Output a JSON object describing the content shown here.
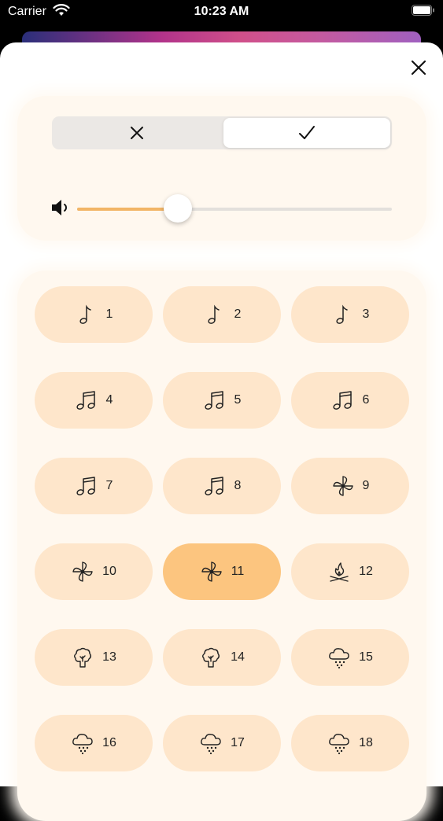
{
  "status_bar": {
    "carrier": "Carrier",
    "time": "10:23 AM"
  },
  "header": {
    "close_icon": "close-icon"
  },
  "mode_toggle": {
    "options": [
      {
        "icon": "x-icon",
        "selected": false
      },
      {
        "icon": "checkmark-icon",
        "selected": true
      }
    ]
  },
  "volume": {
    "icon": "speaker-icon",
    "level": 0.32,
    "fill_color": "#f2b566"
  },
  "sounds": {
    "selected_index": 10,
    "button_color": "#fee6cb",
    "selected_color": "#fcc57f",
    "items": [
      {
        "label": "1",
        "icon": "music-note-icon"
      },
      {
        "label": "2",
        "icon": "music-note-icon"
      },
      {
        "label": "3",
        "icon": "music-note-icon"
      },
      {
        "label": "4",
        "icon": "double-music-note-icon"
      },
      {
        "label": "5",
        "icon": "double-music-note-icon"
      },
      {
        "label": "6",
        "icon": "double-music-note-icon"
      },
      {
        "label": "7",
        "icon": "double-music-note-icon"
      },
      {
        "label": "8",
        "icon": "double-music-note-icon"
      },
      {
        "label": "9",
        "icon": "fan-icon"
      },
      {
        "label": "10",
        "icon": "fan-icon"
      },
      {
        "label": "11",
        "icon": "fan-icon"
      },
      {
        "label": "12",
        "icon": "campfire-icon"
      },
      {
        "label": "13",
        "icon": "tree-icon"
      },
      {
        "label": "14",
        "icon": "tree-icon"
      },
      {
        "label": "15",
        "icon": "rain-cloud-icon"
      },
      {
        "label": "16",
        "icon": "rain-cloud-icon"
      },
      {
        "label": "17",
        "icon": "rain-cloud-icon"
      },
      {
        "label": "18",
        "icon": "rain-cloud-icon"
      }
    ]
  }
}
